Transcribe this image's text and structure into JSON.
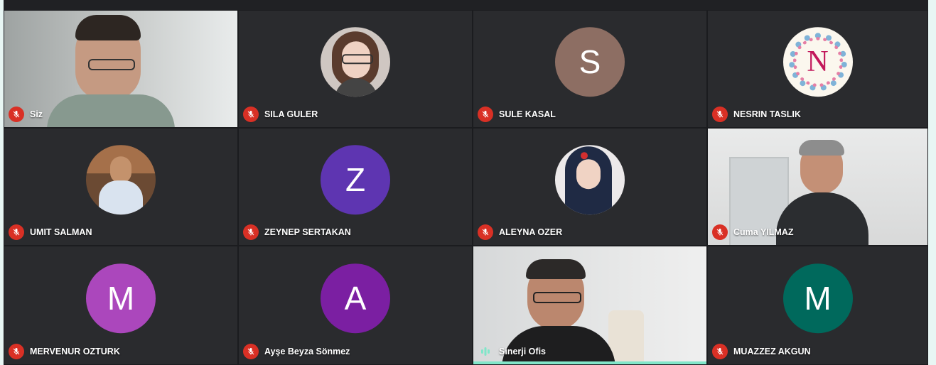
{
  "participants": [
    {
      "name": "Siz",
      "type": "video",
      "mic": "muted"
    },
    {
      "name": "SILA GULER",
      "type": "photo",
      "mic": "muted"
    },
    {
      "name": "SULE KASAL",
      "type": "initial",
      "initial": "S",
      "color": "#8d6e63",
      "mic": "muted"
    },
    {
      "name": "NESRIN TASLIK",
      "type": "photo",
      "initial": "N",
      "mic": "muted"
    },
    {
      "name": "UMIT SALMAN",
      "type": "photo",
      "mic": "muted"
    },
    {
      "name": "ZEYNEP SERTAKAN",
      "type": "initial",
      "initial": "Z",
      "color": "#5e35b1",
      "mic": "muted"
    },
    {
      "name": "ALEYNA OZER",
      "type": "photo",
      "mic": "muted"
    },
    {
      "name": "Cuma YILMAZ",
      "type": "video",
      "mic": "muted"
    },
    {
      "name": "MERVENUR OZTURK",
      "type": "initial",
      "initial": "M",
      "color": "#ab47bc",
      "mic": "muted"
    },
    {
      "name": "Ayşe Beyza Sönmez",
      "type": "initial",
      "initial": "A",
      "color": "#7b1fa2",
      "mic": "muted"
    },
    {
      "name": "Sinerji Ofis",
      "type": "video",
      "mic": "speaking",
      "active": true
    },
    {
      "name": "MUAZZEZ AKGUN",
      "type": "initial",
      "initial": "M",
      "color": "#00695c",
      "mic": "muted"
    }
  ],
  "colors": {
    "background": "#202124",
    "muted_mic": "#d93025",
    "active_speaker": "#81e6c9"
  },
  "icons": {
    "muted": "mic-off-icon",
    "speaking": "audio-level-icon"
  }
}
